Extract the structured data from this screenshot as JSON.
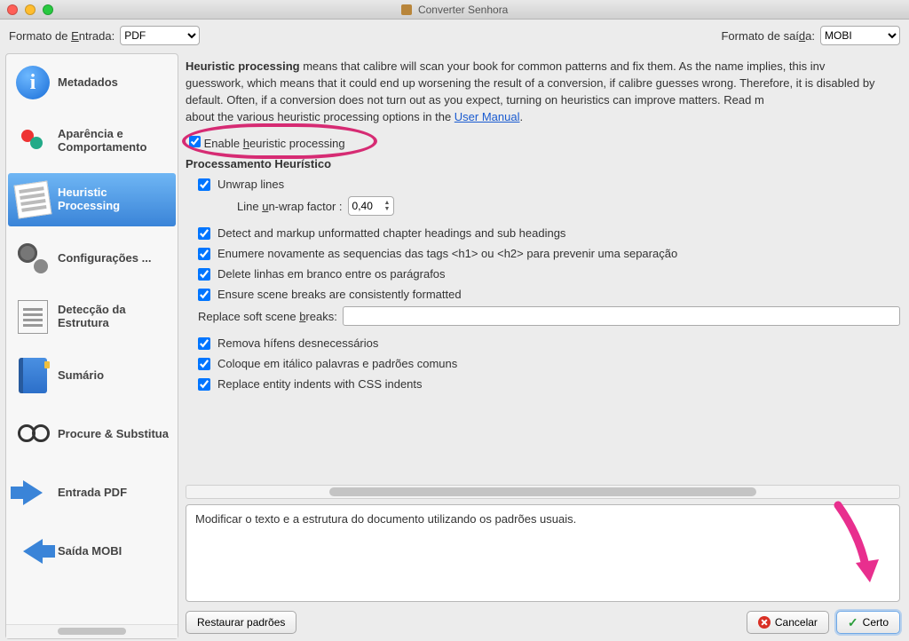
{
  "window": {
    "title": "Converter Senhora"
  },
  "formatbar": {
    "input_label_pre": "Formato de ",
    "input_label_hot": "E",
    "input_label_post": "ntrada:",
    "input_value": "PDF",
    "output_label_pre": "Formato de saí",
    "output_label_hot": "d",
    "output_label_post": "a:",
    "output_value": "MOBI"
  },
  "sidebar": {
    "items": [
      {
        "label": "Metadados"
      },
      {
        "label": "Aparência e Comportamento"
      },
      {
        "label": "Heuristic Processing"
      },
      {
        "label": "Configurações ..."
      },
      {
        "label": "Detecção da Estrutura"
      },
      {
        "label": "Sumário"
      },
      {
        "label": "Procure & Substitua"
      },
      {
        "label": "Entrada PDF"
      },
      {
        "label": "Saída MOBI"
      }
    ]
  },
  "content": {
    "intro_bold": "Heuristic processing",
    "intro_text_1": " means that calibre will scan your book for common patterns and fix them. As the name implies, this inv",
    "intro_text_2": "guesswork, which means that it could end up worsening the result of a conversion, if calibre guesses wrong. Therefore, it is disabled by default. Often, if a conversion does not turn out as you expect, turning on heuristics can improve matters. Read m",
    "intro_text_3": "about the various heuristic processing options in the ",
    "intro_link": "User Manual",
    "intro_text_4": ".",
    "enable_pre": "Enable ",
    "enable_hot": "h",
    "enable_post": "euristic processing",
    "group_title": "Processamento Heurístico",
    "unwrap": "Unwrap lines",
    "unwrap_factor_pre": "Line ",
    "unwrap_factor_hot": "u",
    "unwrap_factor_post": "n-wrap factor :",
    "unwrap_value": "0,40",
    "detect": "Detect and markup unformatted chapter headings and sub headings",
    "renumber": "Enumere novamente as sequencias das tags <h1> ou <h2> para prevenir uma separação",
    "delete_blank": "Delete linhas em branco entre os parágrafos",
    "scene_breaks": "Ensure scene breaks are consistently formatted",
    "replace_label_pre": "Replace soft scene ",
    "replace_label_hot": "b",
    "replace_label_post": "reaks:",
    "replace_value": "",
    "remove_hyphen": "Remova hífens desnecessários",
    "italicize": "Coloque em itálico palavras e padrões comuns",
    "css_indent": "Replace entity indents with CSS indents",
    "description": "Modificar o texto e a estrutura do documento utilizando os padrões usuais."
  },
  "buttons": {
    "restore": "Restaurar padrões",
    "cancel": "Cancelar",
    "ok": "Certo"
  }
}
